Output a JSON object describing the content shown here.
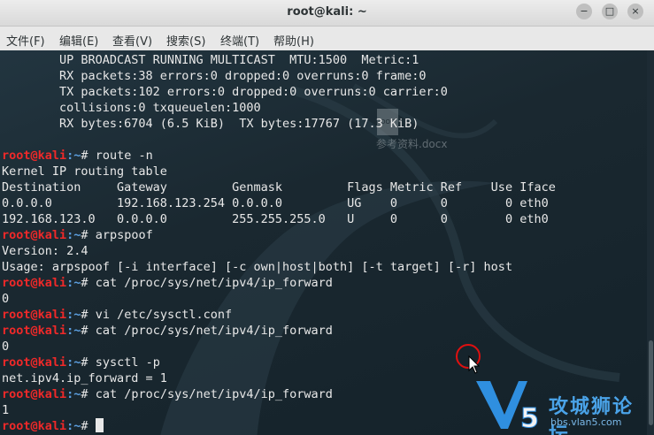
{
  "window": {
    "title": "root@kali: ~",
    "controls": {
      "minimize": "−",
      "maximize": "□",
      "close": "×"
    }
  },
  "menu": [
    {
      "label": "文件(F)"
    },
    {
      "label": "编辑(E)"
    },
    {
      "label": "查看(V)"
    },
    {
      "label": "搜索(S)"
    },
    {
      "label": "终端(T)"
    },
    {
      "label": "帮助(H)"
    }
  ],
  "terminal": {
    "prompt": {
      "user": "root@kali",
      "path": ":~",
      "symbol": "# "
    },
    "lines": [
      {
        "type": "out",
        "text": "        UP BROADCAST RUNNING MULTICAST  MTU:1500  Metric:1"
      },
      {
        "type": "out",
        "text": "        RX packets:38 errors:0 dropped:0 overruns:0 frame:0"
      },
      {
        "type": "out",
        "text": "        TX packets:102 errors:0 dropped:0 overruns:0 carrier:0"
      },
      {
        "type": "out",
        "text": "        collisions:0 txqueuelen:1000"
      },
      {
        "type": "out",
        "text": "        RX bytes:6704 (6.5 KiB)  TX bytes:17767 (17.3 KiB)"
      },
      {
        "type": "out",
        "text": ""
      },
      {
        "type": "cmd",
        "text": "route -n"
      },
      {
        "type": "out",
        "text": "Kernel IP routing table"
      },
      {
        "type": "out",
        "text": "Destination     Gateway         Genmask         Flags Metric Ref    Use Iface"
      },
      {
        "type": "out",
        "text": "0.0.0.0         192.168.123.254 0.0.0.0         UG    0      0        0 eth0"
      },
      {
        "type": "out",
        "text": "192.168.123.0   0.0.0.0         255.255.255.0   U     0      0        0 eth0"
      },
      {
        "type": "cmd",
        "text": "arpspoof"
      },
      {
        "type": "out",
        "text": "Version: 2.4"
      },
      {
        "type": "out",
        "text": "Usage: arpspoof [-i interface] [-c own|host|both] [-t target] [-r] host"
      },
      {
        "type": "cmd",
        "text": "cat /proc/sys/net/ipv4/ip_forward"
      },
      {
        "type": "out",
        "text": "0"
      },
      {
        "type": "cmd",
        "text": "vi /etc/sysctl.conf"
      },
      {
        "type": "cmd",
        "text": "cat /proc/sys/net/ipv4/ip_forward"
      },
      {
        "type": "out",
        "text": "0"
      },
      {
        "type": "cmd",
        "text": "sysctl -p"
      },
      {
        "type": "out",
        "text": "net.ipv4.ip_forward = 1"
      },
      {
        "type": "cmd",
        "text": "cat /proc/sys/net/ipv4/ip_forward"
      },
      {
        "type": "out",
        "text": "1"
      },
      {
        "type": "prompt",
        "text": ""
      }
    ]
  },
  "watermark": {
    "doc_label": "DOC",
    "file_name": "参考资料.docx",
    "site_name": "攻城狮论坛",
    "site_url": "bbs.vlan5.com"
  },
  "colors": {
    "prompt_user": "#ef2929",
    "prompt_path": "#5c9fe0",
    "text": "#e8e8e8",
    "background": "#1b2a33"
  }
}
